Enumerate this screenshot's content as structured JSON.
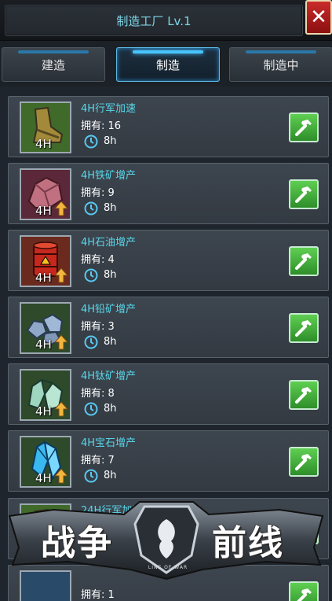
{
  "header": {
    "title": "制造工厂 Lv.1",
    "close_glyph": "✕"
  },
  "tabs": [
    {
      "label": "建造",
      "active": false
    },
    {
      "label": "制造",
      "active": true
    },
    {
      "label": "制造中",
      "active": false
    }
  ],
  "items": [
    {
      "name": "4H行军加速",
      "owned": "拥有: 16",
      "time": "8h",
      "icon_label": "4H",
      "icon": "boot-icon",
      "bg": "#3f6a2a"
    },
    {
      "name": "4H铁矿增产",
      "owned": "拥有: 9",
      "time": "8h",
      "icon_label": "4H",
      "icon": "iron-ore-icon",
      "bg": "#5a2838"
    },
    {
      "name": "4H石油增产",
      "owned": "拥有: 4",
      "time": "8h",
      "icon_label": "4H",
      "icon": "oil-barrel-icon",
      "bg": "#6a2a1e"
    },
    {
      "name": "4H铅矿增产",
      "owned": "拥有: 3",
      "time": "8h",
      "icon_label": "4H",
      "icon": "lead-ore-icon",
      "bg": "#2e4a2a"
    },
    {
      "name": "4H钛矿增产",
      "owned": "拥有: 8",
      "time": "8h",
      "icon_label": "4H",
      "icon": "titanium-ore-icon",
      "bg": "#2e4a2a"
    },
    {
      "name": "4H宝石增产",
      "owned": "拥有: 7",
      "time": "8h",
      "icon_label": "4H",
      "icon": "gem-icon",
      "bg": "#2e4a2a"
    },
    {
      "name": "24H行军加速",
      "owned": "",
      "time": "",
      "icon_label": "",
      "icon": "boot-icon",
      "bg": "#3f6a2a"
    },
    {
      "name": "",
      "owned": "拥有: 1",
      "time": "",
      "icon_label": "",
      "icon": "item-icon",
      "bg": "#2a4a6a"
    }
  ],
  "banner": {
    "left_text": "战争",
    "right_text": "前线",
    "subtitle": "LINE OF WAR"
  },
  "colors": {
    "accent": "#59d7ea",
    "build_button": "#4cb544",
    "close_button": "#b81e1e"
  }
}
